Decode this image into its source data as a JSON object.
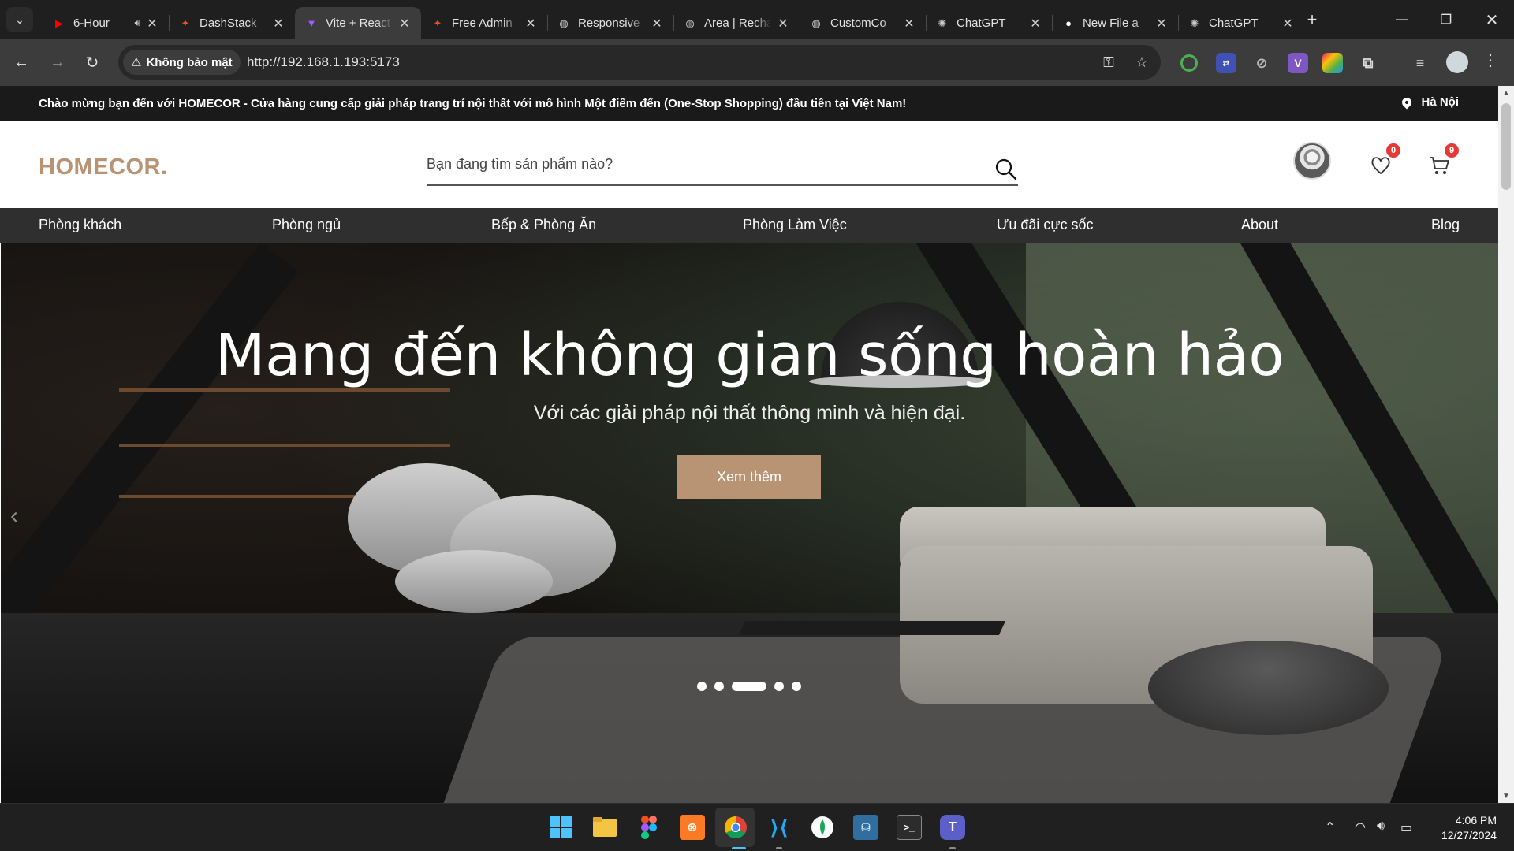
{
  "browser": {
    "tabs": [
      {
        "title": "6-Hour",
        "favicon": "youtube-icon",
        "color": "#ff0000",
        "audio": true
      },
      {
        "title": "DashStack",
        "favicon": "figma-icon",
        "color": "#f24e1e"
      },
      {
        "title": "Vite + React",
        "favicon": "vite-icon",
        "color": "#a259ff",
        "active": true
      },
      {
        "title": "Free Admin",
        "favicon": "figma-icon",
        "color": "#f24e1e"
      },
      {
        "title": "Responsive",
        "favicon": "globe-icon",
        "color": "#cccccc"
      },
      {
        "title": "Area | Recharts",
        "favicon": "globe-icon",
        "color": "#cccccc"
      },
      {
        "title": "CustomCo",
        "favicon": "globe-icon",
        "color": "#cccccc"
      },
      {
        "title": "ChatGPT",
        "favicon": "chatgpt-icon",
        "color": "#cccccc"
      },
      {
        "title": "New File a",
        "favicon": "github-icon",
        "color": "#ffffff"
      },
      {
        "title": "ChatGPT",
        "favicon": "chatgpt-icon",
        "color": "#cccccc"
      }
    ],
    "security_label": "Không bảo mật",
    "url": "http://192.168.1.193:5173"
  },
  "site": {
    "announcement": "Chào mừng bạn đến với HOMECOR - Cửa hàng cung cấp giải pháp trang trí nội thất với mô hình Một điểm đến (One-Stop Shopping) đầu tiên tại Việt Nam!",
    "location": "Hà Nội",
    "logo": "HOMECOR.",
    "search_placeholder": "Bạn đang tìm sản phẩm nào?",
    "wishlist_count": "0",
    "cart_count": "9",
    "nav": [
      "Phòng khách",
      "Phòng ngủ",
      "Bếp & Phòng Ăn",
      "Phòng Làm Việc",
      "Ưu đãi cực sốc",
      "About",
      "Blog"
    ],
    "hero": {
      "title": "Mang đến không gian sống hoàn hảo",
      "subtitle": "Với các giải pháp nội thất thông minh và hiện đại.",
      "button": "Xem thêm",
      "slide_count": 5,
      "active_slide": 3
    }
  },
  "taskbar": {
    "time": "4:06 PM",
    "date": "12/27/2024"
  },
  "colors": {
    "accent": "#b89474",
    "badge": "#e53935"
  }
}
